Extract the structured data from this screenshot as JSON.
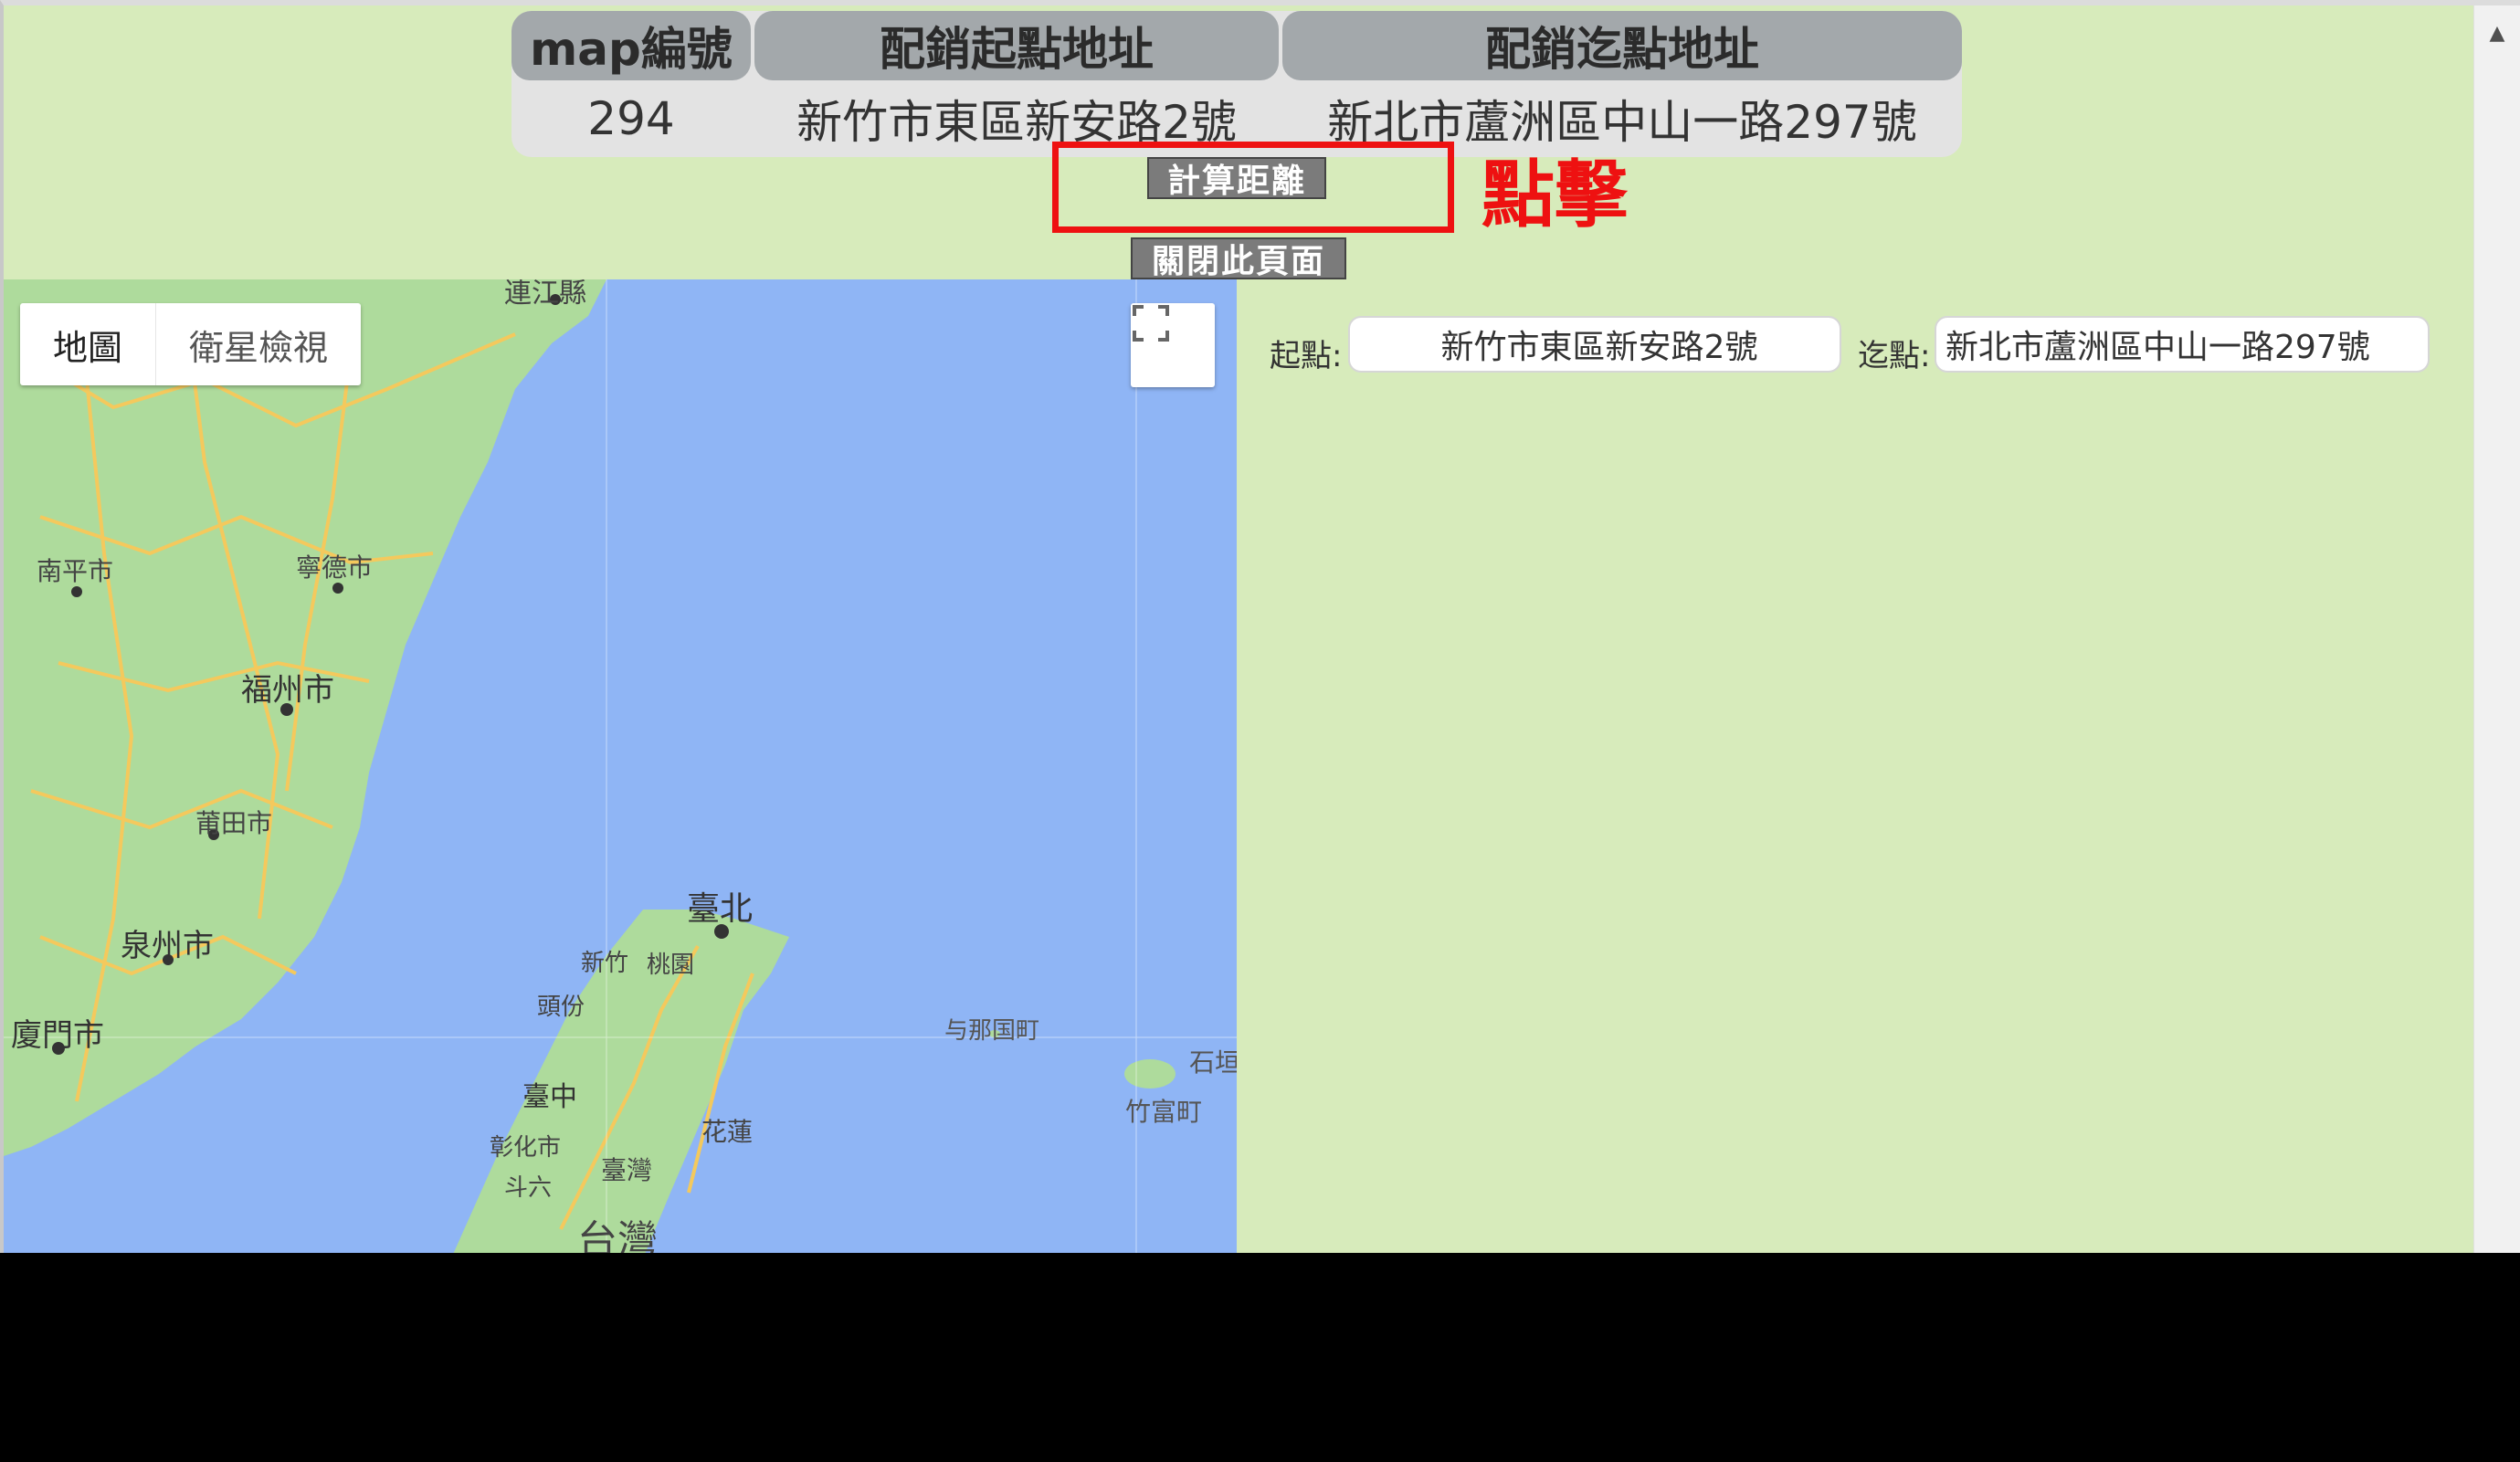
{
  "table": {
    "headers": [
      "map編號",
      "配銷起點地址",
      "配銷迄點地址"
    ],
    "row": [
      "294",
      "新竹市東區新安路2號",
      "新北市蘆洲區中山一路297號"
    ]
  },
  "buttons": {
    "calc": "計算距離",
    "close": "關閉此頁面"
  },
  "annotation": "點擊",
  "map": {
    "type_map": "地圖",
    "type_satellite": "衛星檢視",
    "labels": {
      "lianjiang": "連江縣",
      "nanping": "南平市",
      "ningde": "寧德市",
      "fuzhou": "福州市",
      "putian": "莆田市",
      "quanzhou": "泉州市",
      "xiamen": "廈門市",
      "taipei": "臺北",
      "hsinchu": "新竹",
      "taoyuan": "桃園",
      "toufen": "頭份",
      "taichung": "臺中",
      "changhua": "彰化市",
      "douliu": "斗六",
      "hualien": "花蓮",
      "taiwan_small": "臺灣",
      "taiwan": "台灣",
      "yonaguni": "与那国町",
      "ishigaki": "石垣",
      "taketomi": "竹富町"
    }
  },
  "route": {
    "start_label": "起點:",
    "start_value": "新竹市東區新安路2號",
    "end_label": "迄點:",
    "end_value": "新北市蘆洲區中山一路297號"
  },
  "colors": {
    "page_bg": "#d7ebbb",
    "sea": "#8fb5f5",
    "land": "#aedb9c",
    "annotation": "#ee1111",
    "button": "#7b7b7b"
  }
}
